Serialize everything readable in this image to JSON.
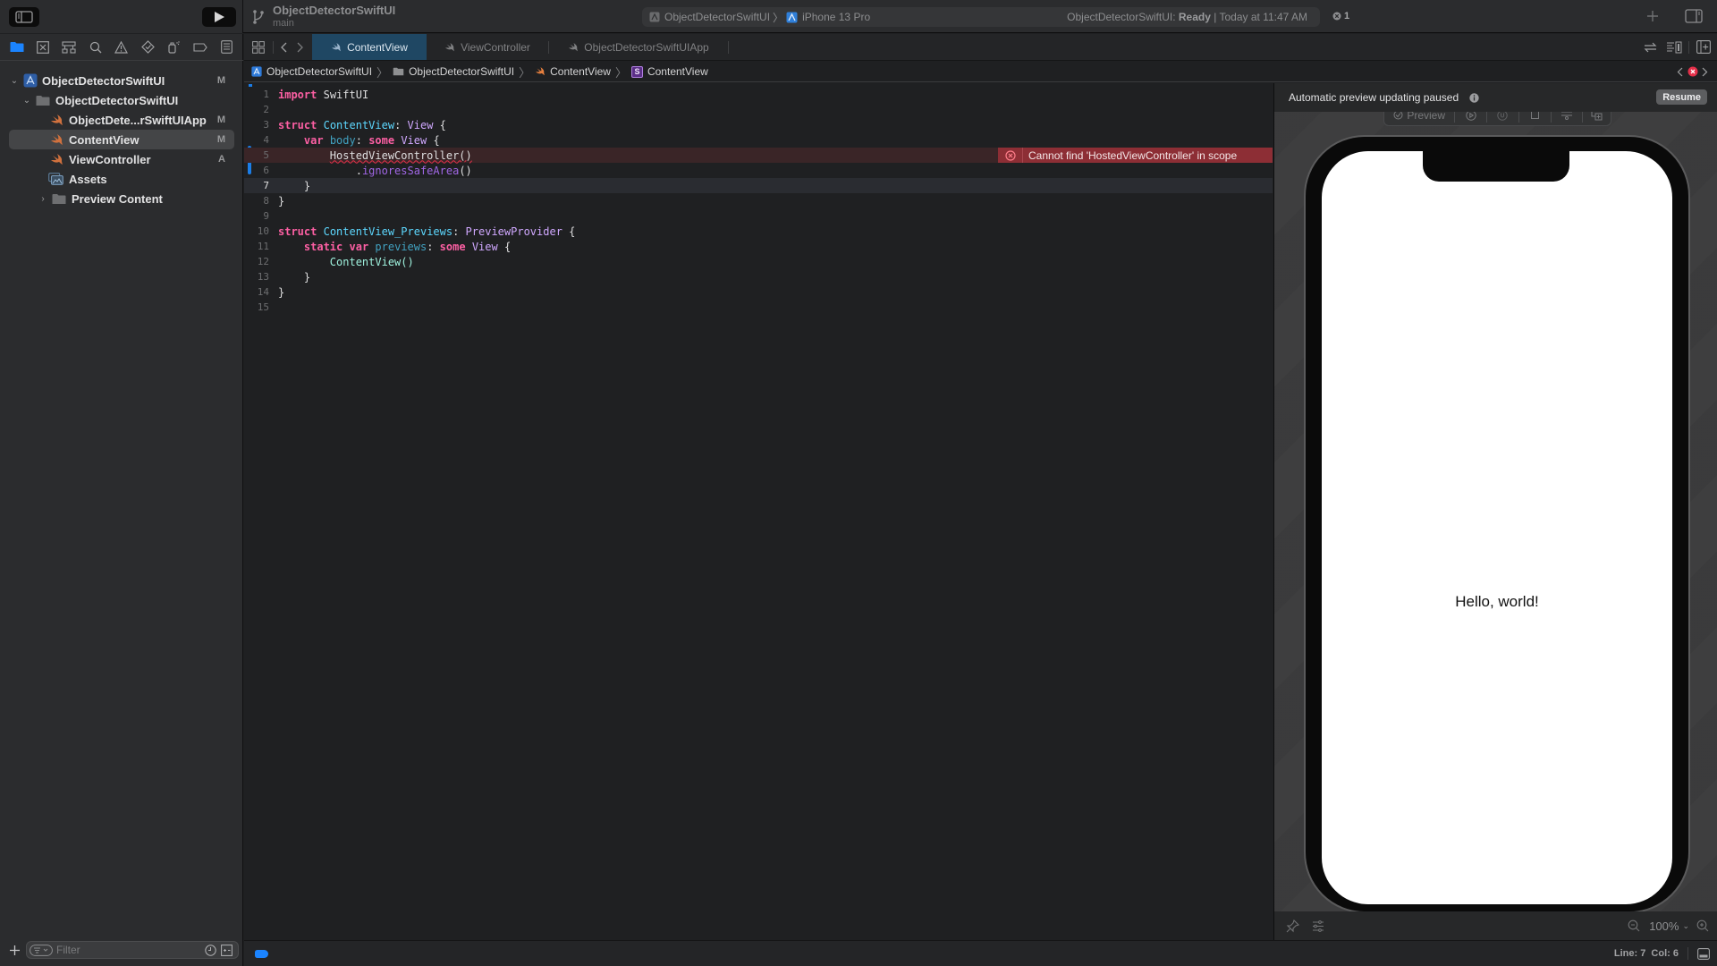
{
  "toolbar": {
    "scheme_title": "ObjectDetectorSwiftUI",
    "branch": "main",
    "activity": {
      "scheme": "ObjectDetectorSwiftUI",
      "destination": "iPhone 13 Pro",
      "status_prefix": "ObjectDetectorSwiftUI:",
      "status_state": "Ready",
      "status_time": "| Today at 11:47 AM"
    },
    "error_count": "1",
    "icons": [
      "sidebar-toggle-icon",
      "run-icon",
      "branch-icon",
      "add-icon",
      "inspector-toggle-icon"
    ]
  },
  "navigator": {
    "tools": [
      "folder-icon",
      "source-control-icon",
      "hierarchy-icon",
      "search-icon",
      "warning-icon",
      "test-icon",
      "debug-icon",
      "breakpoint-icon",
      "report-icon"
    ],
    "tree": [
      {
        "label": "ObjectDetectorSwiftUI",
        "status": "M",
        "kind": "project",
        "expanded": true
      },
      {
        "label": "ObjectDetectorSwiftUI",
        "status": "",
        "kind": "folder",
        "expanded": true
      },
      {
        "label": "ObjectDete...rSwiftUIApp",
        "status": "M",
        "kind": "swift"
      },
      {
        "label": "ContentView",
        "status": "M",
        "kind": "swift",
        "selected": true
      },
      {
        "label": "ViewController",
        "status": "A",
        "kind": "swift"
      },
      {
        "label": "Assets",
        "status": "",
        "kind": "assets"
      },
      {
        "label": "Preview Content",
        "status": "",
        "kind": "folder",
        "expanded": false
      }
    ],
    "filter_placeholder": "Filter"
  },
  "tabs": [
    {
      "label": "ContentView",
      "active": true
    },
    {
      "label": "ViewController",
      "active": false
    },
    {
      "label": "ObjectDetectorSwiftUIApp",
      "active": false
    }
  ],
  "jumpbar": [
    "ObjectDetectorSwiftUI",
    "ObjectDetectorSwiftUI",
    "ContentView",
    "ContentView"
  ],
  "code": {
    "lines": [
      "1",
      "2",
      "3",
      "4",
      "5",
      "6",
      "7",
      "8",
      "9",
      "10",
      "11",
      "12",
      "13",
      "14",
      "15"
    ],
    "tokens": {
      "import": "import",
      "swiftui": "SwiftUI",
      "struct": "struct",
      "contentview": "ContentView",
      "colon_view": ": ",
      "view": "View",
      "brace_open": " {",
      "var": "var",
      "body": "body",
      "some": "some",
      "hosted": "HostedViewController()",
      "ignores_dot": ".",
      "ignores": "ignoresSafeArea",
      "parens": "()",
      "brace_close": "}",
      "previews_struct": "ContentView_Previews",
      "preview_provider": "PreviewProvider",
      "static": "static",
      "previews": "previews",
      "contentview_call": "ContentView()"
    },
    "error_message": "Cannot find 'HostedViewController' in scope",
    "current_line": 7
  },
  "canvas": {
    "paused_message": "Automatic preview updating paused",
    "resume_label": "Resume",
    "preview_label": "Preview",
    "device_text": "Hello, world!",
    "zoom_level": "100%"
  },
  "statusbar": {
    "position": "Line: 7  Col: 6"
  }
}
